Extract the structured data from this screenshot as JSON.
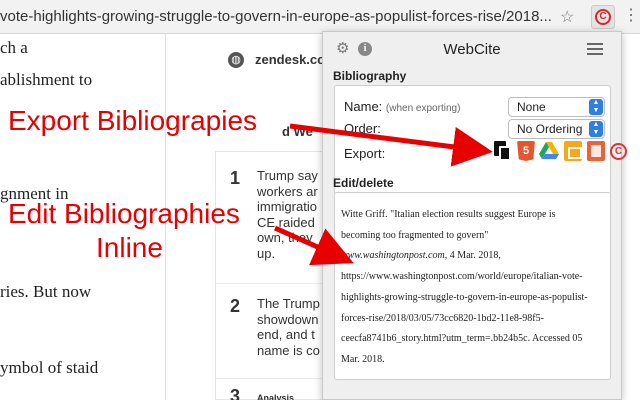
{
  "browser": {
    "url": "vote-highlights-growing-struggle-to-govern-in-europe-as-populist-forces-rise/2018..."
  },
  "article_left": {
    "lines": [
      "ch a",
      "ablishment to",
      "",
      "",
      "gnment in",
      "",
      "",
      "ries. But now",
      "",
      "ymbol of staid"
    ]
  },
  "middle": {
    "source": "zendesk.com",
    "heading_fragment": "d We",
    "items": [
      {
        "number": "1",
        "text": "Trump say\nworkers ar\nimmigratio\nCE raided\nown, they\nup."
      },
      {
        "number": "2",
        "text": "The Trump\nshowdown\nend, and t\nname is co"
      },
      {
        "number": "3",
        "text": "Analysis"
      }
    ]
  },
  "popup": {
    "title": "WebCite",
    "bibliography": {
      "section_label": "Bibliography",
      "name_label": "Name:",
      "name_hint": "(when exporting)",
      "name_value": "None",
      "order_label": "Order:",
      "order_value": "No Ordering",
      "export_label": "Export:",
      "export_icons": [
        "copy-icon",
        "html5-icon",
        "google-drive-icon",
        "google-slides-icon",
        "book-icon",
        "webcite-icon"
      ]
    },
    "edit": {
      "section_label": "Edit/delete",
      "citation": {
        "line1": "Witte Griff. \"Italian election results suggest Europe is",
        "line2": "becoming too fragmented to govern\"",
        "publication": "www.washingtonpost.com",
        "date": ", 4 Mar. 2018,",
        "line4": "https://www.washingtonpost.com/world/europe/italian-vote-",
        "line5": "highlights-growing-struggle-to-govern-in-europe-as-populist-",
        "line6": "forces-rise/2018/03/05/73cc6820-1bd2-11e8-98f5-",
        "line7": "ceecfa8741b6_story.html?utm_term=.bb24b5c. Accessed 05",
        "line8": "Mar. 2018."
      }
    }
  },
  "annotations": {
    "export": "Export Bibliograpies",
    "edit_line1": "Edit Bibliographies",
    "edit_line2": "Inline"
  },
  "colors": {
    "annotation": "#e60000",
    "accent": "#2f7fe3"
  }
}
